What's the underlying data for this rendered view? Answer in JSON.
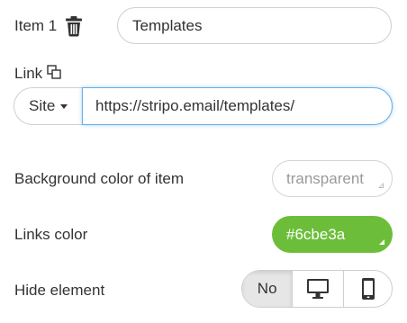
{
  "item": {
    "label": "Item 1",
    "value": "Templates"
  },
  "link": {
    "label": "Link",
    "select_value": "Site",
    "url": "https://stripo.email/templates/"
  },
  "background_color": {
    "label": "Background color of item",
    "value": "transparent"
  },
  "links_color": {
    "label": "Links color",
    "value": "#6cbe3a",
    "color": "#6cbe3a"
  },
  "hide_element": {
    "label": "Hide element",
    "no_label": "No",
    "options": [
      "desktop-icon",
      "mobile-icon"
    ]
  },
  "icons": {
    "delete": "trash-icon",
    "copy": "copy-icon"
  }
}
